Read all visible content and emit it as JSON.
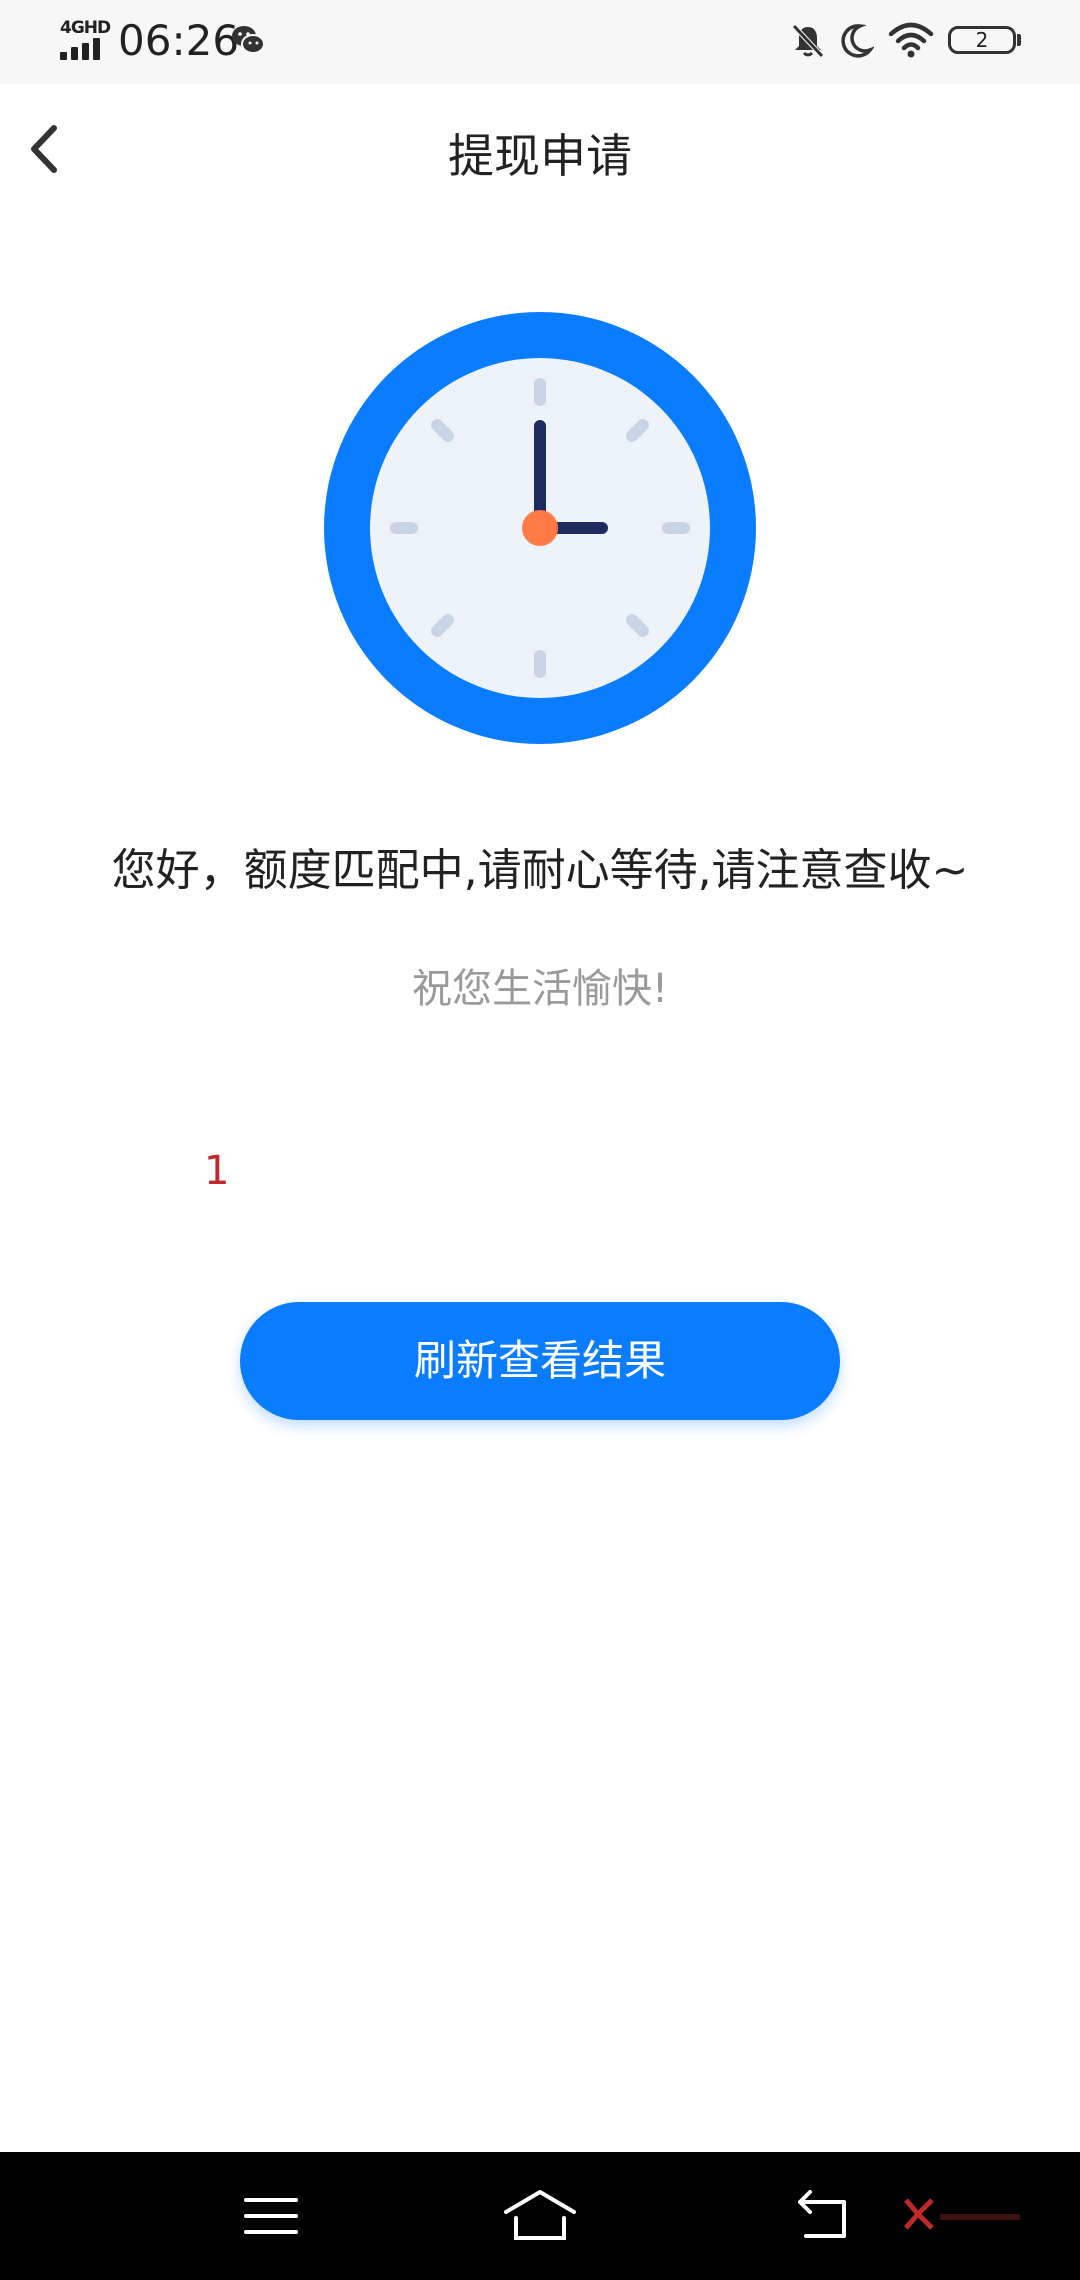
{
  "status_bar": {
    "network": "4GHD",
    "time": "06:26",
    "battery": "2"
  },
  "header": {
    "title": "提现申请"
  },
  "main": {
    "message": "您好，额度匹配中,请耐心等待,请注意查收~",
    "sub_message": "祝您生活愉快!",
    "red_number": "1",
    "refresh_button": "刷新查看结果"
  },
  "colors": {
    "accent": "#0a7cff",
    "clock_face": "#eef3fa",
    "clock_hand": "#1d2b5e",
    "clock_center": "#ff7a45",
    "red_text": "#c0282a"
  },
  "icons": {
    "back": "chevron-left-icon",
    "wechat": "wechat-icon",
    "bell_off": "bell-off-icon",
    "moon": "moon-icon",
    "wifi": "wifi-icon",
    "menu": "menu-icon",
    "home": "home-icon",
    "nav_back": "back-icon"
  }
}
